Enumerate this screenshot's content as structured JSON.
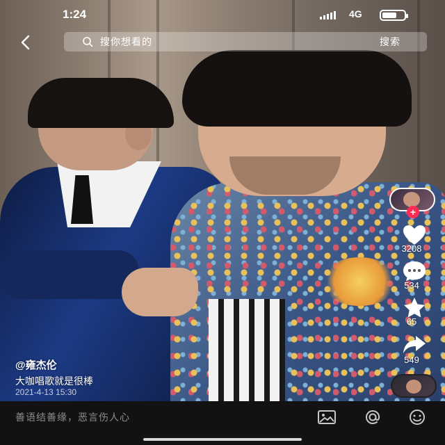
{
  "status_bar": {
    "time": "1:24",
    "network": "4G"
  },
  "search": {
    "placeholder": "搜你想看的",
    "button_label": "搜索"
  },
  "video": {
    "author": "@雍杰伦",
    "description": "大咖唱歌就是很棒",
    "date": "2021-4-13 15:30"
  },
  "actions": {
    "follow_label": "+",
    "likes": "3208",
    "comments": "534",
    "favorites": "65",
    "shares": "549"
  },
  "comment_bar": {
    "placeholder": "善语结善缘，恶言伤人心"
  },
  "icons": [
    "back-icon",
    "search-icon",
    "heart-icon",
    "comment-icon",
    "star-icon",
    "share-icon",
    "image-icon",
    "at-icon",
    "emoji-icon"
  ],
  "colors": {
    "follow": "#ff2c55",
    "bar_bg": "#121212"
  }
}
